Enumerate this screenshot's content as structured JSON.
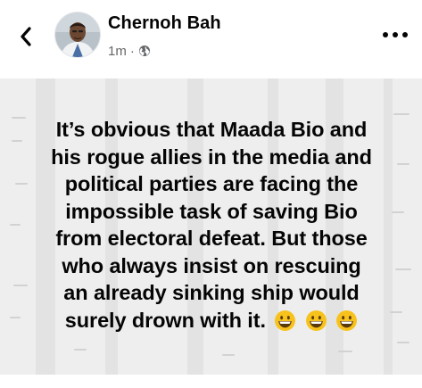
{
  "header": {
    "back_icon": "chevron-left-icon",
    "author_name": "Chernoh Bah",
    "timestamp": "1m",
    "separator": "·",
    "audience_icon": "globe-icon",
    "more_icon": "ellipsis-horizontal-icon"
  },
  "post": {
    "text_lines": [
      "It’s obvious that Maada Bio and",
      "his rogue allies in the media and",
      "political parties are facing the",
      "impossible task of saving Bio",
      "from electoral defeat. But those",
      "who always insist on rescuing",
      "an already sinking ship would",
      "surely drown with it."
    ],
    "emoji_name": "grinning-face-emoji",
    "emoji_count": 3,
    "background_color": "#eeeeee",
    "text_color": "#050505"
  }
}
